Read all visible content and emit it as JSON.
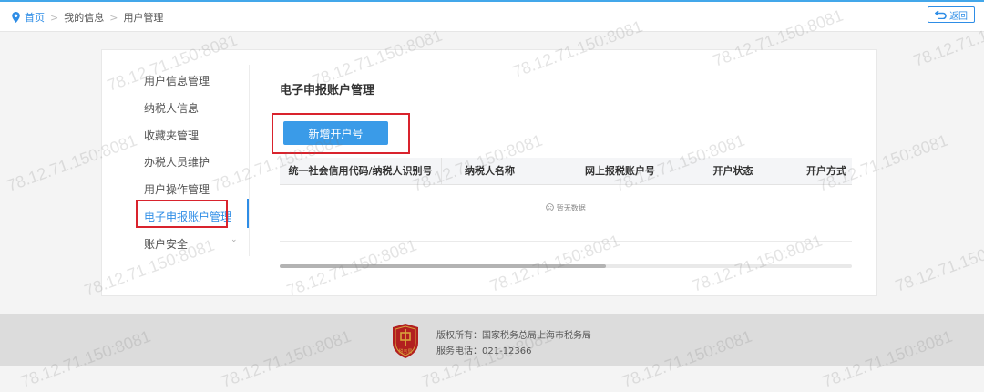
{
  "breadcrumb": {
    "home": "首页",
    "separator": ">",
    "mid": "我的信息",
    "current": "用户管理"
  },
  "back_button": {
    "label": "返回",
    "icon": "return-arrow-icon"
  },
  "sidebar": {
    "items": [
      {
        "label": "用户信息管理"
      },
      {
        "label": "纳税人信息"
      },
      {
        "label": "收藏夹管理"
      },
      {
        "label": "办税人员维护"
      },
      {
        "label": "用户操作管理"
      },
      {
        "label": "电子申报账户管理",
        "active": true
      },
      {
        "label": "账户安全",
        "expandable": true
      }
    ]
  },
  "main": {
    "title": "电子申报账户管理",
    "add_button": "新增开户号",
    "table": {
      "columns": [
        "统一社会信用代码/纳税人识别号",
        "纳税人名称",
        "网上报税账户号",
        "开户状态",
        "开户方式"
      ],
      "empty_text": "暂无数据"
    },
    "scroll_position": 0.57
  },
  "footer": {
    "copyright": "版权所有：国家税务总局上海市税务局",
    "phone": "服务电话：021-12366",
    "logo_text": "税务局"
  },
  "watermark": "78.12.71.150:8081",
  "colors": {
    "accent": "#2e8de6",
    "button": "#3a9be8",
    "highlight": "#d9232d",
    "footer_bg": "#dcdcdc",
    "logo_red": "#b21f1f",
    "logo_gold": "#d7a23b"
  }
}
